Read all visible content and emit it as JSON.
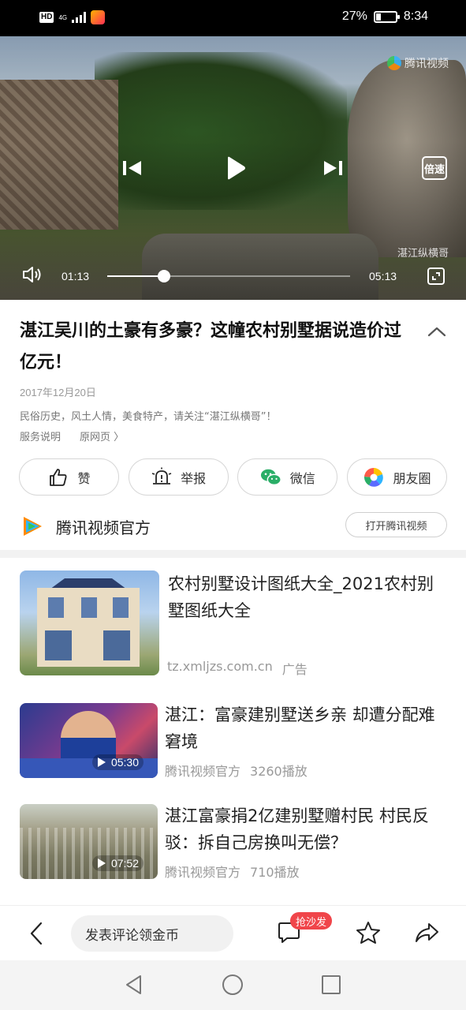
{
  "status_bar": {
    "hd": "HD",
    "network": "4G",
    "battery_percent": "27%",
    "battery_level": 0.27,
    "time": "8:34"
  },
  "video": {
    "watermark_brand": "腾讯视频",
    "watermark_channel": "湛江纵横哥",
    "speed_label": "倍速",
    "current_time": "01:13",
    "total_time": "05:13",
    "progress": 0.233
  },
  "article": {
    "title": "湛江吴川的土豪有多豪？这幢农村别墅据说造价过亿元！",
    "date": "2017年12月20日",
    "description": "民俗历史，风土人情，美食特产，请关注“湛江纵横哥”！",
    "service_link": "服务说明",
    "original_link": "原网页 〉"
  },
  "actions": {
    "like": "赞",
    "report": "举报",
    "wechat": "微信",
    "moments": "朋友圈"
  },
  "channel": {
    "name": "腾讯视频官方",
    "open_button": "打开腾讯视频"
  },
  "recommendations": [
    {
      "title": "农村别墅设计图纸大全_2021农村别墅图纸大全",
      "source": "tz.xmljzs.com.cn",
      "tag": "广告"
    },
    {
      "title": "湛江：富豪建别墅送乡亲 却遭分配难窘境",
      "source": "腾讯视频官方",
      "plays": "3260播放",
      "duration": "05:30"
    },
    {
      "title": "湛江富豪捐2亿建别墅赠村民 村民反驳：拆自己房换叫无偿？",
      "source": "腾讯视频官方",
      "plays": "710播放",
      "duration": "07:52"
    }
  ],
  "toolbar": {
    "comment_placeholder": "发表评论领金币",
    "sofa_badge": "抢沙发"
  },
  "colors": {
    "accent_red": "#f0454a",
    "text_primary": "#111111",
    "text_secondary": "#999999"
  }
}
